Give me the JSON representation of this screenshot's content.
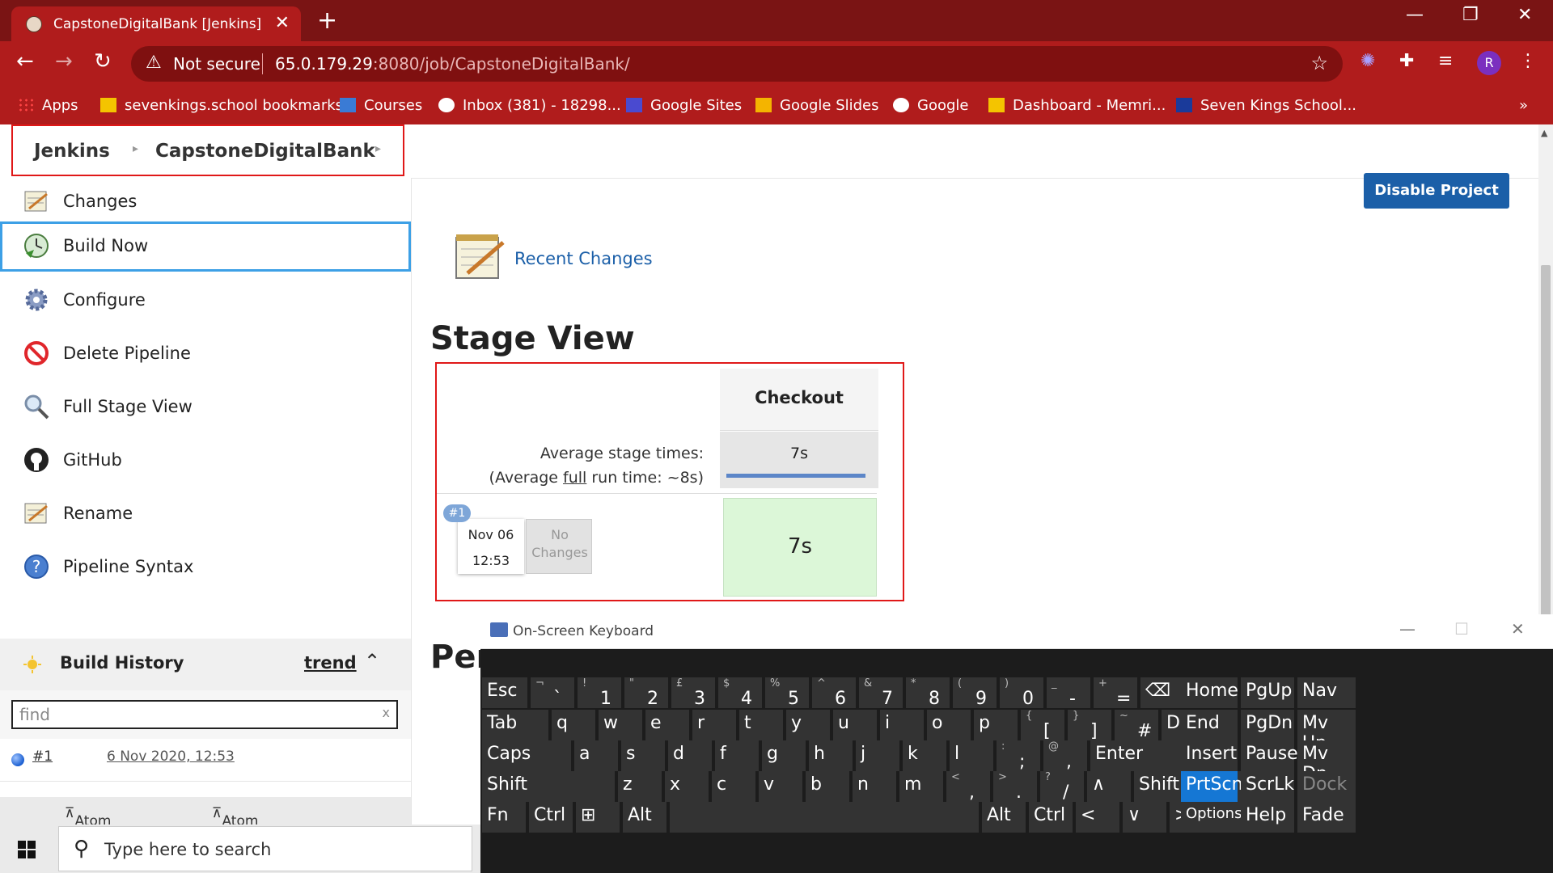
{
  "browser": {
    "tab_title": "CapstoneDigitalBank [Jenkins]",
    "not_secure": "Not secure",
    "url_host": "65.0.179.29",
    "url_rest": ":8080/job/CapstoneDigitalBank/",
    "profile_initial": "R"
  },
  "bookmarks": [
    {
      "label": "Apps"
    },
    {
      "label": "sevenkings.school bookmarks"
    },
    {
      "label": "Courses"
    },
    {
      "label": "Inbox (381) - 18298..."
    },
    {
      "label": "Google Sites"
    },
    {
      "label": "Google Slides"
    },
    {
      "label": "Google"
    },
    {
      "label": "Dashboard - Memri..."
    },
    {
      "label": "Seven Kings School..."
    }
  ],
  "breadcrumb": {
    "root": "Jenkins",
    "job": "CapstoneDigitalBank"
  },
  "tasks": [
    {
      "label": "Changes"
    },
    {
      "label": "Build Now"
    },
    {
      "label": "Configure"
    },
    {
      "label": "Delete Pipeline"
    },
    {
      "label": "Full Stage View"
    },
    {
      "label": "GitHub"
    },
    {
      "label": "Rename"
    },
    {
      "label": "Pipeline Syntax"
    }
  ],
  "build_history": {
    "title": "Build History",
    "trend": "trend",
    "find_placeholder": "find",
    "builds": [
      {
        "number": "#1",
        "date": "6 Nov 2020, 12:53"
      }
    ],
    "feed_all": "Atom feed for all",
    "feed_failures": "Atom feed for failures"
  },
  "main": {
    "disable_button": "Disable Project",
    "recent_changes": "Recent Changes",
    "stage_view_title": "Stage View",
    "next_section_title": "Per",
    "stage_name": "Checkout",
    "avg_label": "Average stage times:",
    "avg_run_prefix": "(Average ",
    "avg_run_full": "full",
    "avg_run_suffix": " run time: ~8s)",
    "avg_stage_time": "7s",
    "run": {
      "badge": "#1",
      "date": "Nov 06",
      "time": "12:53",
      "changes": "No Changes",
      "stage_time": "7s"
    }
  },
  "osk": {
    "title": "On-Screen Keyboard",
    "rows": [
      [
        {
          "k": "Esc"
        },
        {
          "s": "¬",
          "k": "`"
        },
        {
          "s": "!",
          "k": "1"
        },
        {
          "s": "\"",
          "k": "2"
        },
        {
          "s": "£",
          "k": "3"
        },
        {
          "s": "$",
          "k": "4"
        },
        {
          "s": "%",
          "k": "5"
        },
        {
          "s": "^",
          "k": "6"
        },
        {
          "s": "&",
          "k": "7"
        },
        {
          "s": "*",
          "k": "8"
        },
        {
          "s": "(",
          "k": "9"
        },
        {
          "s": ")",
          "k": "0"
        },
        {
          "s": "_",
          "k": "-"
        },
        {
          "s": "+",
          "k": "="
        },
        {
          "k": "⌫"
        }
      ],
      [
        {
          "k": "Tab"
        },
        {
          "k": "q"
        },
        {
          "k": "w"
        },
        {
          "k": "e"
        },
        {
          "k": "r"
        },
        {
          "k": "t"
        },
        {
          "k": "y"
        },
        {
          "k": "u"
        },
        {
          "k": "i"
        },
        {
          "k": "o"
        },
        {
          "k": "p"
        },
        {
          "s": "{",
          "k": "["
        },
        {
          "s": "}",
          "k": "]"
        },
        {
          "s": "~",
          "k": "#"
        },
        {
          "k": "Del"
        }
      ],
      [
        {
          "k": "Caps"
        },
        {
          "k": "a"
        },
        {
          "k": "s"
        },
        {
          "k": "d"
        },
        {
          "k": "f"
        },
        {
          "k": "g"
        },
        {
          "k": "h"
        },
        {
          "k": "j"
        },
        {
          "k": "k"
        },
        {
          "k": "l"
        },
        {
          "s": ":",
          "k": ";"
        },
        {
          "s": "@",
          "k": ","
        },
        {
          "k": "Enter"
        }
      ],
      [
        {
          "k": "Shift"
        },
        {
          "k": "z"
        },
        {
          "k": "x"
        },
        {
          "k": "c"
        },
        {
          "k": "v"
        },
        {
          "k": "b"
        },
        {
          "k": "n"
        },
        {
          "k": "m"
        },
        {
          "s": "<",
          "k": ","
        },
        {
          "s": ">",
          "k": "."
        },
        {
          "s": "?",
          "k": "/"
        },
        {
          "k": "∧"
        },
        {
          "k": "Shift"
        }
      ],
      [
        {
          "k": "Fn"
        },
        {
          "k": "Ctrl"
        },
        {
          "k": "⊞"
        },
        {
          "k": "Alt"
        },
        {
          "k": ""
        },
        {
          "k": "Alt"
        },
        {
          "k": "Ctrl"
        },
        {
          "k": "<"
        },
        {
          "k": "∨"
        },
        {
          "k": ">"
        },
        {
          "k": "▤"
        }
      ]
    ],
    "side": [
      [
        "Home",
        "PgUp",
        "Nav"
      ],
      [
        "End",
        "PgDn",
        "Mv Up"
      ],
      [
        "Insert",
        "Pause",
        "Mv Dn"
      ],
      [
        "PrtScn",
        "ScrLk",
        "Dock"
      ],
      [
        "Options",
        "Help",
        "Fade"
      ]
    ]
  },
  "taskbar": {
    "search_placeholder": "Type here to search"
  },
  "colors": {
    "browser_chrome": "#b01c1c",
    "jenkins_link": "#1b5fa8",
    "highlight_red": "#e01818",
    "success_green": "#dcf7d8",
    "osk_highlight": "#1577d4"
  }
}
